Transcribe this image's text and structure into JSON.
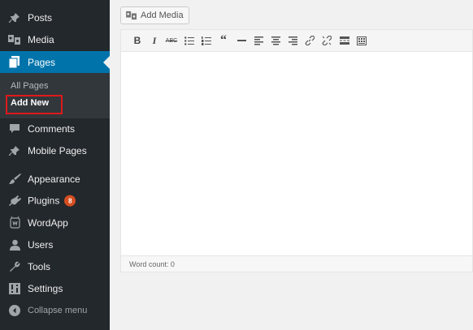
{
  "sidebar": {
    "items": {
      "posts": "Posts",
      "media": "Media",
      "pages": "Pages",
      "comments": "Comments",
      "mobile_pages": "Mobile Pages",
      "appearance": "Appearance",
      "plugins": "Plugins",
      "plugins_badge": "8",
      "wordapp": "WordApp",
      "users": "Users",
      "tools": "Tools",
      "settings": "Settings",
      "collapse": "Collapse menu"
    },
    "submenu": {
      "all_pages": "All Pages",
      "add_new": "Add New"
    }
  },
  "editor": {
    "add_media_label": "Add Media",
    "word_count": "Word count: 0"
  },
  "colors": {
    "sidebar_bg": "#23282d",
    "active_bg": "#0073aa",
    "highlight": "#dd1a1a",
    "badge": "#d54e21"
  },
  "toolbar_icons": [
    "bold-icon",
    "italic-icon",
    "strikethrough-icon",
    "bullet-list-icon",
    "numbered-list-icon",
    "blockquote-icon",
    "horizontal-line-icon",
    "align-left-icon",
    "align-center-icon",
    "align-right-icon",
    "link-icon",
    "unlink-icon",
    "read-more-icon",
    "toolbar-toggle-icon"
  ]
}
